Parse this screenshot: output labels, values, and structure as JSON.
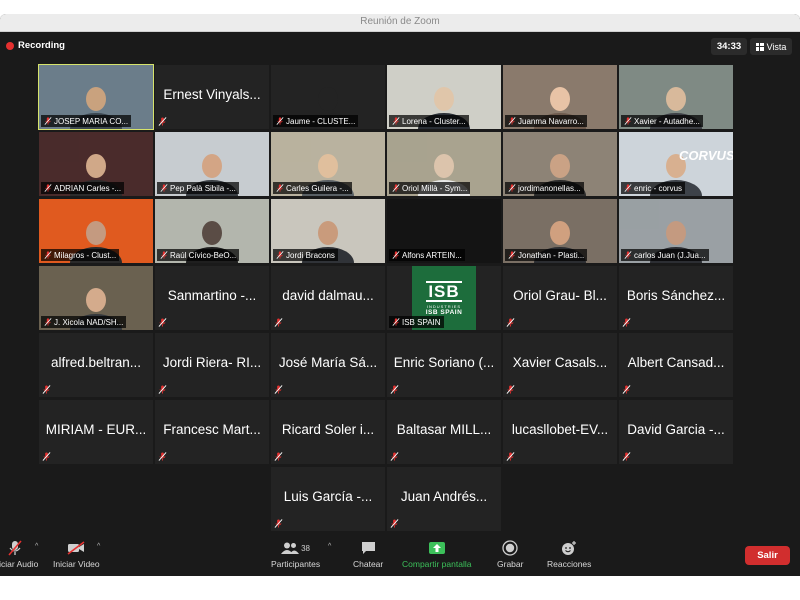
{
  "window": {
    "title": "Reunión de Zoom"
  },
  "topbar": {
    "recording_label": "Recording",
    "timer": "34:33",
    "view_label": "Vista"
  },
  "participants": [
    {
      "name": "JOSEP MARIA CO...",
      "video": true,
      "speaking": true
    },
    {
      "name": "Ernest Vinyals...",
      "video": false
    },
    {
      "name": "Jaume - CLUSTE...",
      "video": true
    },
    {
      "name": "Lorena - Cluster...",
      "video": true
    },
    {
      "name": "Juanma Navarro...",
      "video": true
    },
    {
      "name": "Xavier - Autadhe...",
      "video": true
    },
    {
      "name": "ADRIAN Carles -...",
      "video": true
    },
    {
      "name": "Pep Palà Sibila -...",
      "video": true
    },
    {
      "name": "Carles Guilera -...",
      "video": true
    },
    {
      "name": "Oriol Millà - Sym...",
      "video": true
    },
    {
      "name": "jordimanonellas...",
      "video": true
    },
    {
      "name": "enric - corvus",
      "video": true
    },
    {
      "name": "Milagros - Clust...",
      "video": true
    },
    {
      "name": "Raúl Cívico-BeO...",
      "video": true
    },
    {
      "name": "Jordi Bracons",
      "video": true
    },
    {
      "name": "Alfons ARTEIN...",
      "video": true
    },
    {
      "name": "Jonathan - Plasti...",
      "video": true
    },
    {
      "name": "carlos Juan (J.Jua...",
      "video": true
    },
    {
      "name": "J. Xicola NAD/SH...",
      "video": true
    },
    {
      "name": "Sanmartino -...",
      "video": false
    },
    {
      "name": "david dalmau...",
      "video": false
    },
    {
      "name": "ISB SPAIN",
      "video": true
    },
    {
      "name": "Oriol Grau- Bl...",
      "video": false
    },
    {
      "name": "Boris Sánchez...",
      "video": false
    },
    {
      "name": "alfred.beltran...",
      "video": false
    },
    {
      "name": "Jordi Riera- RI...",
      "video": false
    },
    {
      "name": "José María Sá...",
      "video": false
    },
    {
      "name": "Enric Soriano (...",
      "video": false
    },
    {
      "name": "Xavier Casals...",
      "video": false
    },
    {
      "name": "Albert Cansad...",
      "video": false
    },
    {
      "name": "MIRIAM - EUR...",
      "video": false
    },
    {
      "name": "Francesc Mart...",
      "video": false
    },
    {
      "name": "Ricard Soler i...",
      "video": false
    },
    {
      "name": "Baltasar MILL...",
      "video": false
    },
    {
      "name": "lucasllobet-EV...",
      "video": false
    },
    {
      "name": "David Garcia -...",
      "video": false
    },
    {
      "name": "Luis García -...",
      "video": false
    },
    {
      "name": "Juan Andrés...",
      "video": false
    }
  ],
  "isb_logo": {
    "text": "ISB",
    "industries": "INDUSTRIES",
    "spain": "ISB SPAIN"
  },
  "corvus_text": "CORVUS",
  "toolbar": {
    "audio_label": "Iniciar Audio",
    "video_label": "Iniciar Video",
    "participants_label": "Participantes",
    "participants_count": "38",
    "chat_label": "Chatear",
    "share_label": "Compartir pantalla",
    "record_label": "Grabar",
    "reactions_label": "Reacciones",
    "exit_label": "Salir"
  },
  "colors": {
    "speaking_border": "#d6e36b",
    "recording": "#e5302f",
    "share_green": "#3cc05a",
    "exit_red": "#d12e2e",
    "tile_bg": "#232323"
  }
}
